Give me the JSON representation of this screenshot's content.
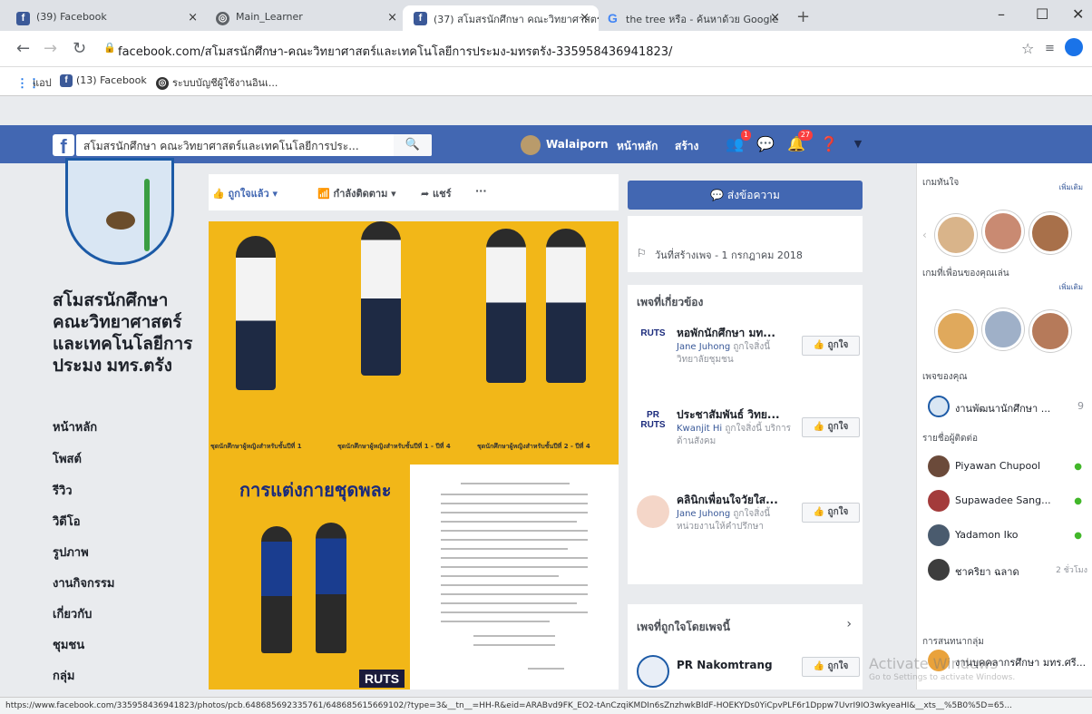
{
  "browser": {
    "tabs": [
      {
        "title": "(39) Facebook",
        "favicon": "facebook-icon"
      },
      {
        "title": "Main_Learner",
        "favicon": "globe-icon"
      },
      {
        "title": "(37) สโมสรนักศึกษา คณะวิทยาศาสตร์",
        "favicon": "facebook-icon"
      },
      {
        "title": "the tree หรือ - ค้นหาด้วย Google",
        "favicon": "google-icon"
      }
    ],
    "url": "facebook.com/สโมสรนักศึกษา-คณะวิทยาศาสตร์และเทคโนโลยีการประมง-มทรตรัง-335958436941823/",
    "bookmarks": [
      {
        "label": "แอป",
        "icon": "apps-grid-icon"
      },
      {
        "label": "(13) Facebook",
        "icon": "facebook-icon"
      },
      {
        "label": "ระบบบัญชีผู้ใช้งานอินเ...",
        "icon": "globe-icon"
      }
    ],
    "status_url": "https://www.facebook.com/335958436941823/photos/pcb.648685692335761/648685615669102/?type=3&__tn__=HH-R&eid=ARABvd9FK_EO2-tAnCzqiKMDIn6sZnzhwkBldF-HOEKYDs0YiCpvPLF6r1Dppw7UvrI9IO3wkyeaHI&__xts__%5B0%5D=65..."
  },
  "fb": {
    "search_value": "สโมสรนักศึกษา คณะวิทยาศาสตร์และเทคโนโลยีการประ...",
    "user_name": "Walaiporn",
    "nav_home": "หน้าหลัก",
    "nav_create": "สร้าง",
    "badge_friends": "1",
    "badge_notifications": "27",
    "brand_color": "#4267b2"
  },
  "page": {
    "title": "สโมสรนักศึกษา คณะวิทยาศาสตร์และเทคโนโลยีการประมง มทร.ตรัง",
    "nav": [
      "หน้าหลัก",
      "โพสต์",
      "รีวิว",
      "วิดีโอ",
      "รูปภาพ",
      "งานกิจกรรม",
      "เกี่ยวกับ",
      "ชุมชน",
      "กลุ่ม"
    ]
  },
  "actions": {
    "liked": "ถูกใจแล้ว",
    "following": "กำลังติดตาม",
    "share": "แชร์",
    "more": "···"
  },
  "photos": {
    "captions": [
      "ชุดนักศึกษาผู้หญิงสำหรับชั้นปีที่ 1",
      "ชุดนักศึกษาผู้หญิงสำหรับชั้นปีที่ 1 - ปีที่ 4",
      "ชุดนักศึกษาผู้หญิงสำหรับชั้นปีที่ 2 - ปีที่ 4"
    ],
    "sport_title": "การแต่งกายชุดพละ",
    "logo_text": "RUTS"
  },
  "right": {
    "send_message": "ส่งข้อความ",
    "created": "วันที่สร้างเพจ - 1 กรกฎาคม 2018",
    "related_heading": "เพจที่เกี่ยวข้อง",
    "like_label": "ถูกใจ",
    "related": [
      {
        "logo": "RUTS",
        "name": "หอพักนักศึกษา มท...",
        "friend": "Jane Juhong",
        "suffix": "ถูกใจสิ่งนี้",
        "category": "วิทยาลัยชุมชน"
      },
      {
        "logo": "PR RUTS",
        "name": "ประชาสัมพันธ์ วิทย...",
        "friend": "Kwanjit Hi",
        "suffix": "ถูกใจสิ่งนี้",
        "category": "บริการด้านสังคม"
      },
      {
        "logo": "",
        "name": "คลินิกเพื่อนใจวัยใส...",
        "friend": "Jane Juhong",
        "suffix": "ถูกใจสิ่งนี้",
        "category": "หน่วยงานให้คำปรึกษา"
      }
    ],
    "liked_by_page_heading": "เพจที่ถูกใจโดยเพจนี้",
    "liked_by_page": {
      "name": "PR Nakomtrang"
    }
  },
  "sidebar": {
    "games_heading": "เกมทันใจ",
    "games_more": "เพิ่มเติม",
    "friends_games_heading": "เกมที่เพื่อนของคุณเล่น",
    "friends_games_more": "เพิ่มเติม",
    "your_pages_heading": "เพจของคุณ",
    "your_page": {
      "name": "งานพัฒนานักศึกษา ...",
      "count": "9"
    },
    "contacts_heading": "รายชื่อผู้ติดต่อ",
    "contacts": [
      {
        "name": "Piyawan Chupool",
        "time": ""
      },
      {
        "name": "Supawadee Sang...",
        "time": ""
      },
      {
        "name": "Yadamon Iko",
        "time": ""
      },
      {
        "name": "ชาคริยา ฉลาด",
        "time": "2 ชั่วโมง"
      }
    ],
    "group_chats_heading": "การสนทนากลุ่ม",
    "group_chat": "งานบุคคลากรศึกษา มทร.ศรี..."
  },
  "os": {
    "activate_title": "Activate Windows",
    "activate_sub": "Go to Settings to activate Windows."
  }
}
